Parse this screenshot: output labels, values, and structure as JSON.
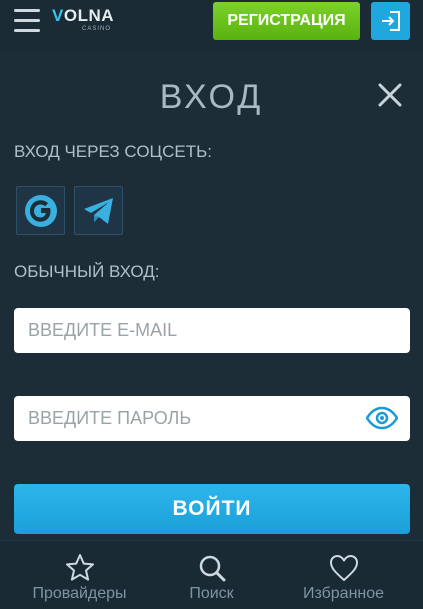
{
  "header": {
    "logo_main_a": "V",
    "logo_main_b": "OLNA",
    "logo_sub": "CASINO",
    "register_label": "РЕГИСТРАЦИЯ"
  },
  "login": {
    "title": "ВХОД",
    "social_label": "ВХОД ЧЕРЕЗ СОЦСЕТЬ:",
    "regular_label": "ОБЫЧНЫЙ ВХОД:",
    "email_placeholder": "ВВЕДИТЕ E-MAIL",
    "password_placeholder": "ВВЕДИТЕ ПАРОЛЬ",
    "submit_label": "ВОЙТИ"
  },
  "bottom_nav": {
    "items": [
      {
        "label": "Провайдеры",
        "icon": "star-icon"
      },
      {
        "label": "Поиск",
        "icon": "search-icon"
      },
      {
        "label": "Избранное",
        "icon": "heart-icon"
      }
    ]
  },
  "colors": {
    "background": "#1d2d38",
    "register_green": "#6cc21c",
    "accent_blue": "#1fa8e0"
  }
}
